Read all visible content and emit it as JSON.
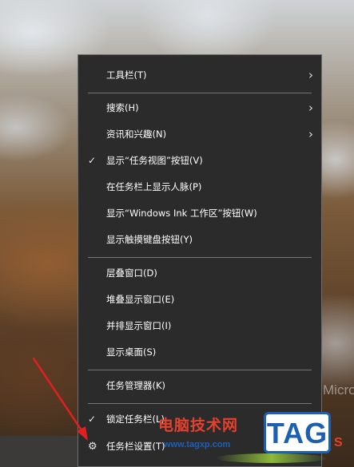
{
  "menu": {
    "items": [
      {
        "label": "工具栏(T)",
        "check": "",
        "arrow": "›"
      },
      {
        "label": "搜索(H)",
        "check": "",
        "arrow": "›"
      },
      {
        "label": "资讯和兴趣(N)",
        "check": "",
        "arrow": "›"
      },
      {
        "label": "显示“任务视图”按钮(V)",
        "check": "✓",
        "arrow": ""
      },
      {
        "label": "在任务栏上显示人脉(P)",
        "check": "",
        "arrow": ""
      },
      {
        "label": "显示“Windows Ink 工作区”按钮(W)",
        "check": "",
        "arrow": ""
      },
      {
        "label": "显示触摸键盘按钮(Y)",
        "check": "",
        "arrow": ""
      },
      {
        "label": "层叠窗口(D)",
        "check": "",
        "arrow": ""
      },
      {
        "label": "堆叠显示窗口(E)",
        "check": "",
        "arrow": ""
      },
      {
        "label": "并排显示窗口(I)",
        "check": "",
        "arrow": ""
      },
      {
        "label": "显示桌面(S)",
        "check": "",
        "arrow": ""
      },
      {
        "label": "任务管理器(K)",
        "check": "",
        "arrow": ""
      },
      {
        "label": "锁定任务栏(L)",
        "check": "✓",
        "arrow": ""
      },
      {
        "label": "任务栏设置(T)",
        "icon": "gear-icon",
        "icon_glyph": "⚙"
      }
    ]
  },
  "desktop": {
    "brand_text": "Micros"
  },
  "watermark": {
    "site_name": "电脑技术网",
    "url": "www.tagxp.com",
    "logo": "TAG",
    "corner_mark": "S"
  },
  "colors": {
    "menu_bg": "#2b2b2b",
    "menu_border": "#6d6d6d",
    "text": "#ffffff",
    "annotation_arrow": "#e02020"
  }
}
